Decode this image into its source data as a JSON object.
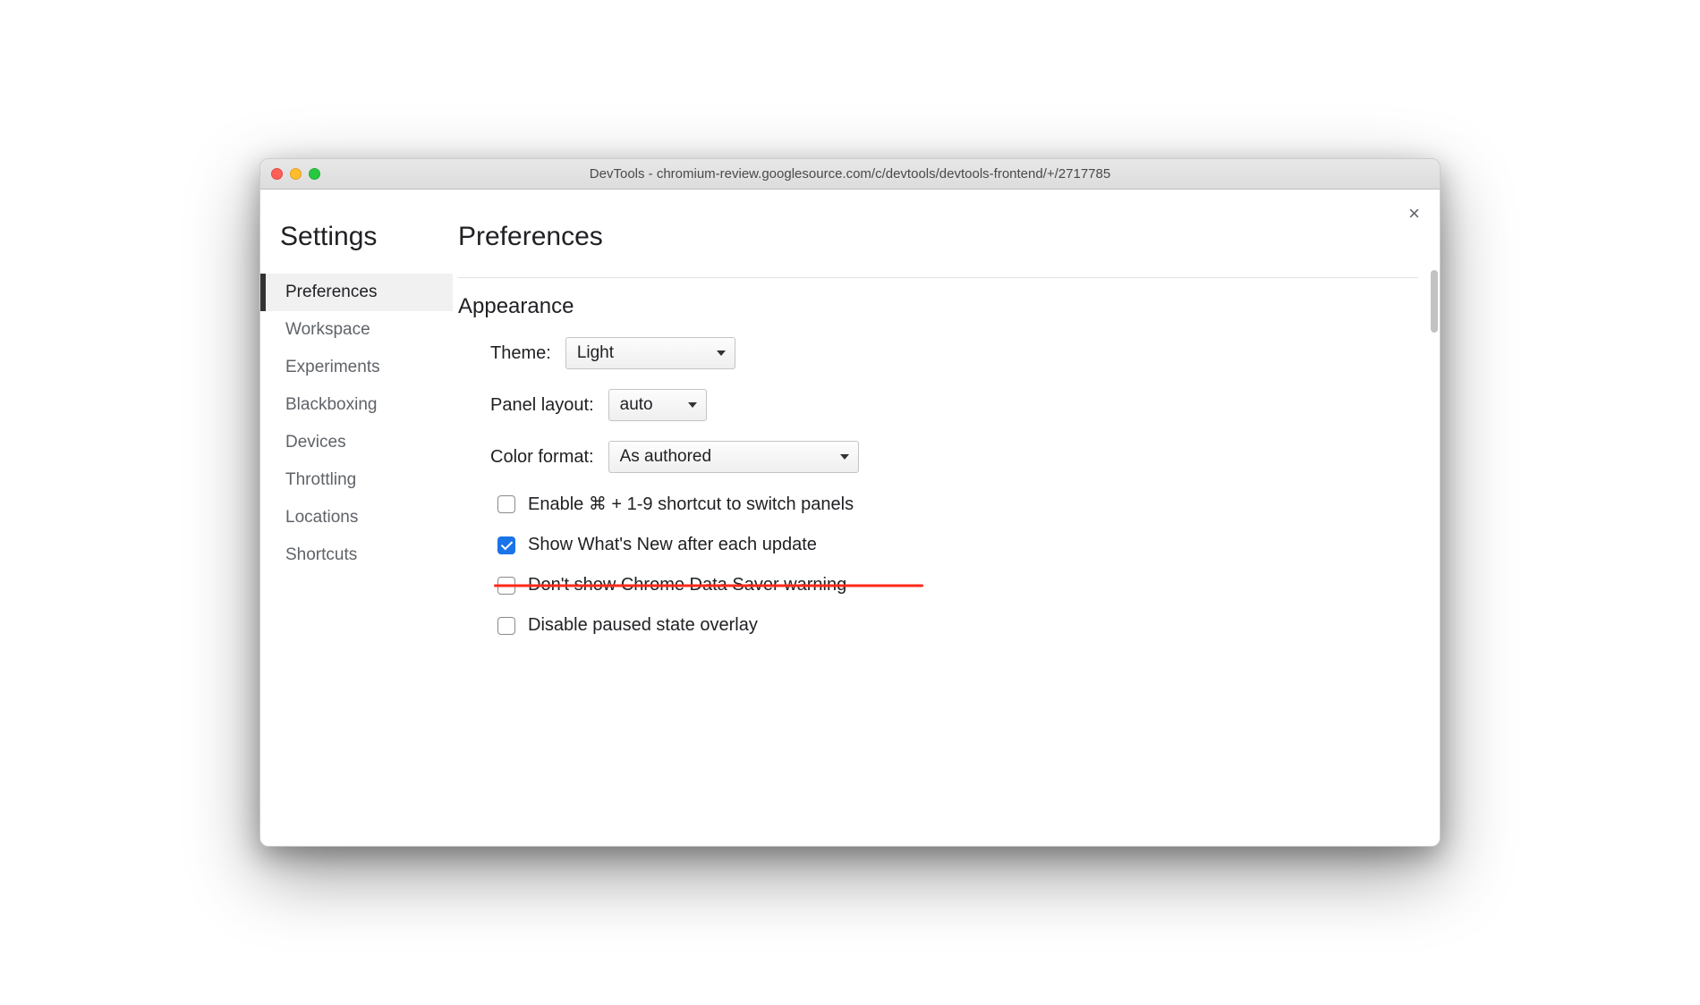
{
  "window": {
    "title": "DevTools - chromium-review.googlesource.com/c/devtools/devtools-frontend/+/2717785"
  },
  "sidebar": {
    "title": "Settings",
    "items": [
      {
        "label": "Preferences",
        "active": true
      },
      {
        "label": "Workspace"
      },
      {
        "label": "Experiments"
      },
      {
        "label": "Blackboxing"
      },
      {
        "label": "Devices"
      },
      {
        "label": "Throttling"
      },
      {
        "label": "Locations"
      },
      {
        "label": "Shortcuts"
      }
    ]
  },
  "main": {
    "title": "Preferences",
    "close": "×",
    "appearance": {
      "heading": "Appearance",
      "theme_label": "Theme:",
      "theme_value": "Light",
      "panel_label": "Panel layout:",
      "panel_value": "auto",
      "color_label": "Color format:",
      "color_value": "As authored",
      "checks": [
        {
          "label": "Enable ⌘ + 1-9 shortcut to switch panels",
          "checked": false,
          "struck": false
        },
        {
          "label": "Show What's New after each update",
          "checked": true,
          "struck": false
        },
        {
          "label": "Don't show Chrome Data Saver warning",
          "checked": false,
          "struck": true
        },
        {
          "label": "Disable paused state overlay",
          "checked": false,
          "struck": false
        }
      ]
    }
  }
}
